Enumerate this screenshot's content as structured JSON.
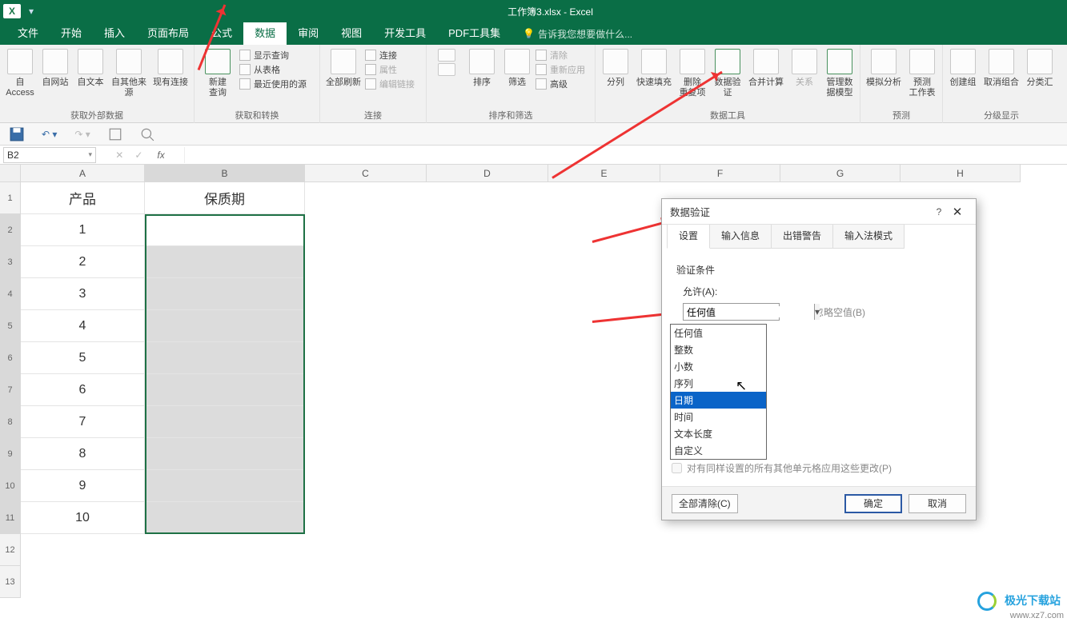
{
  "titlebar": {
    "title": "工作簿3.xlsx - Excel"
  },
  "tabs": {
    "items": [
      "文件",
      "开始",
      "插入",
      "页面布局",
      "公式",
      "数据",
      "审阅",
      "视图",
      "开发工具",
      "PDF工具集"
    ],
    "active_index": 5,
    "tell_me": "告诉我您想要做什么..."
  },
  "ribbon": {
    "group_get_external": {
      "label": "获取外部数据",
      "buttons": [
        "自 Access",
        "自网站",
        "自文本",
        "自其他来源",
        "现有连接"
      ]
    },
    "group_get_transform": {
      "label": "获取和转换",
      "new_query": "新建\n查询",
      "items": [
        "显示查询",
        "从表格",
        "最近使用的源"
      ]
    },
    "group_connections": {
      "label": "连接",
      "refresh_all": "全部刷新",
      "items": [
        "连接",
        "属性",
        "编辑链接"
      ]
    },
    "group_sort_filter": {
      "label": "排序和筛选",
      "sort": "排序",
      "filter": "筛选",
      "items": [
        "清除",
        "重新应用",
        "高级"
      ]
    },
    "group_data_tools": {
      "label": "数据工具",
      "buttons": [
        "分列",
        "快速填充",
        "删除\n重复项",
        "数据验\n证",
        "合并计算",
        "关系",
        "管理数\n据模型"
      ]
    },
    "group_forecast": {
      "label": "预测",
      "buttons": [
        "模拟分析",
        "预测\n工作表"
      ]
    },
    "group_outline": {
      "label": "分级显示",
      "buttons": [
        "创建组",
        "取消组合",
        "分类汇"
      ]
    }
  },
  "formula_bar": {
    "name_box": "B2",
    "fx": "fx"
  },
  "grid": {
    "columns": [
      "A",
      "B",
      "C",
      "D",
      "E",
      "F",
      "G",
      "H"
    ],
    "row_numbers": [
      1,
      2,
      3,
      4,
      5,
      6,
      7,
      8,
      9,
      10,
      11,
      12,
      13
    ],
    "header_row": {
      "A": "产品",
      "B": "保质期"
    },
    "col_a_values": [
      "1",
      "2",
      "3",
      "4",
      "5",
      "6",
      "7",
      "8",
      "9",
      "10"
    ]
  },
  "dialog": {
    "title": "数据验证",
    "tabs": [
      "设置",
      "输入信息",
      "出错警告",
      "输入法模式"
    ],
    "active_tab_index": 0,
    "section_label": "验证条件",
    "allow_label": "允许(A):",
    "allow_value": "任何值",
    "ignore_blank_label": "忽略空值(B)",
    "ignore_blank_checked": true,
    "allow_options": [
      "任何值",
      "整数",
      "小数",
      "序列",
      "日期",
      "时间",
      "文本长度",
      "自定义"
    ],
    "allow_highlight_index": 4,
    "apply_changes_label": "对有同样设置的所有其他单元格应用这些更改(P)",
    "clear_all": "全部清除(C)",
    "ok": "确定",
    "cancel": "取消"
  },
  "watermark": {
    "brand": "极光下载站",
    "url": "www.xz7.com"
  }
}
